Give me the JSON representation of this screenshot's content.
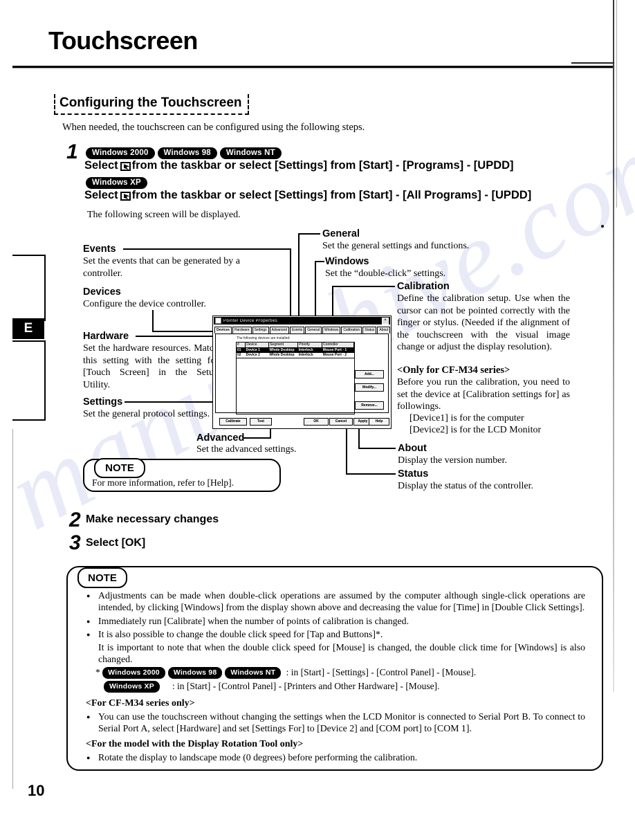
{
  "page": {
    "title": "Touchscreen",
    "number": "10",
    "tab_marker": "E"
  },
  "section": {
    "heading": "Configuring the Touchscreen",
    "intro": "When needed, the touchscreen can be configured using the following steps."
  },
  "steps": {
    "one": {
      "num": "1",
      "badges_a": [
        "Windows 2000",
        "Windows 98",
        "Windows NT"
      ],
      "line_a_pre": "Select",
      "line_a_post": "from the taskbar or select [Settings] from [Start] - [Programs] - [UPDD]",
      "badges_b": [
        "Windows XP"
      ],
      "line_b_pre": "Select",
      "line_b_post": "from the taskbar or select [Settings] from [Start] - [All Programs] - [UPDD]",
      "note": "The following screen will be displayed."
    },
    "two": {
      "num": "2",
      "text": "Make necessary changes"
    },
    "three": {
      "num": "3",
      "text": "Select [OK]"
    }
  },
  "annotations": {
    "events": {
      "title": "Events",
      "body": "Set the events that can be generated by a controller."
    },
    "devices": {
      "title": "Devices",
      "body": "Configure the device controller."
    },
    "hardware": {
      "title": "Hardware",
      "body": "Set the hardware resources. Match this setting with the setting for [Touch Screen] in the Setup Utility."
    },
    "settings": {
      "title": "Settings",
      "body": "Set the general protocol settings."
    },
    "advanced": {
      "title": "Advanced",
      "body": "Set the advanced settings."
    },
    "general": {
      "title": "General",
      "body": "Set the general settings and functions."
    },
    "windows": {
      "title": "Windows",
      "body": "Set the “double-click” settings."
    },
    "calibration": {
      "title": "Calibration",
      "body": "Define the calibration setup. Use when the cursor can not be pointed correctly with the finger or stylus. (Needed if the alignment of the touchscreen with the visual image change or adjust the display resolution).",
      "subhead": "<Only for CF-M34 series>",
      "body2": "Before you run the calibration, you need to set the device at [Calibration settings for] as followings.",
      "device1": "[Device1] is for the computer",
      "device2": "[Device2] is for the LCD Monitor"
    },
    "about": {
      "title": "About",
      "body": "Display the version number."
    },
    "status": {
      "title": "Status",
      "body": "Display the status of the controller."
    }
  },
  "dialog": {
    "title": "Pointer Device Properties",
    "close_label": "×",
    "tabs": [
      "Devices",
      "Hardware",
      "Settings",
      "Advanced",
      "Events",
      "General",
      "Windows",
      "Calibration",
      "Status",
      "About"
    ],
    "active_tab": "Devices",
    "body_label": "The following devices are installed:",
    "columns": [
      "#",
      "Device",
      "Segment",
      "Priority",
      "Controller"
    ],
    "rows": [
      {
        "num": "01",
        "device": "Device 1",
        "segment": "Whole Desktop",
        "priority": "Interlock",
        "controller": "Mouse Port - 1"
      },
      {
        "num": "02",
        "device": "Device 2",
        "segment": "Whole Desktop",
        "priority": "Interlock",
        "controller": "Mouse Port - 2"
      }
    ],
    "selected_row": 0,
    "side_buttons": [
      "Add...",
      "Modify...",
      "Remove..."
    ],
    "footer_left": [
      "Calibrate",
      "Test"
    ],
    "footer_right": [
      "OK",
      "Cancel",
      "Apply",
      "Help"
    ]
  },
  "note1": {
    "badge": "NOTE",
    "text": "For more information, refer to [Help]."
  },
  "note2": {
    "badge": "NOTE",
    "bullets": [
      "Adjustments can be made when double-click operations are assumed by the computer although single-click operations are intended, by clicking [Windows] from the display shown above and decreasing the value for [Time] in [Double Click Settings].",
      "Immediately run [Calibrate] when the number of points of calibration is changed.",
      "It is also possible to change the double click speed for [Tap and Buttons]*."
    ],
    "sub_after_third": "It is important to note that when the double click speed for [Mouse] is changed, the double click time for [Windows] is also changed.",
    "os_line_a_badges": [
      "Windows 2000",
      "Windows 98",
      "Windows NT"
    ],
    "os_line_a_text": ": in [Start] - [Settings] - [Control Panel] - [Mouse].",
    "os_line_a_prefix": "*",
    "os_line_b_badges": [
      "Windows XP"
    ],
    "os_line_b_text": ": in [Start] - [Control Panel] - [Printers and Other Hardware] - [Mouse].",
    "section_cfm34_head": "<For CF-M34 series only>",
    "section_cfm34_bullet": "You can use the touchscreen without changing the settings when the LCD Monitor is connected to Serial Port B. To connect to Serial Port A, select [Hardware] and set [Settings For] to [Device 2] and [COM port] to [COM 1].",
    "section_rotation_head": "<For the model with the Display Rotation Tool only>",
    "section_rotation_bullet": "Rotate the display to landscape mode (0 degrees) before performing the calibration."
  },
  "watermark": {
    "text": "manualshive.com"
  }
}
